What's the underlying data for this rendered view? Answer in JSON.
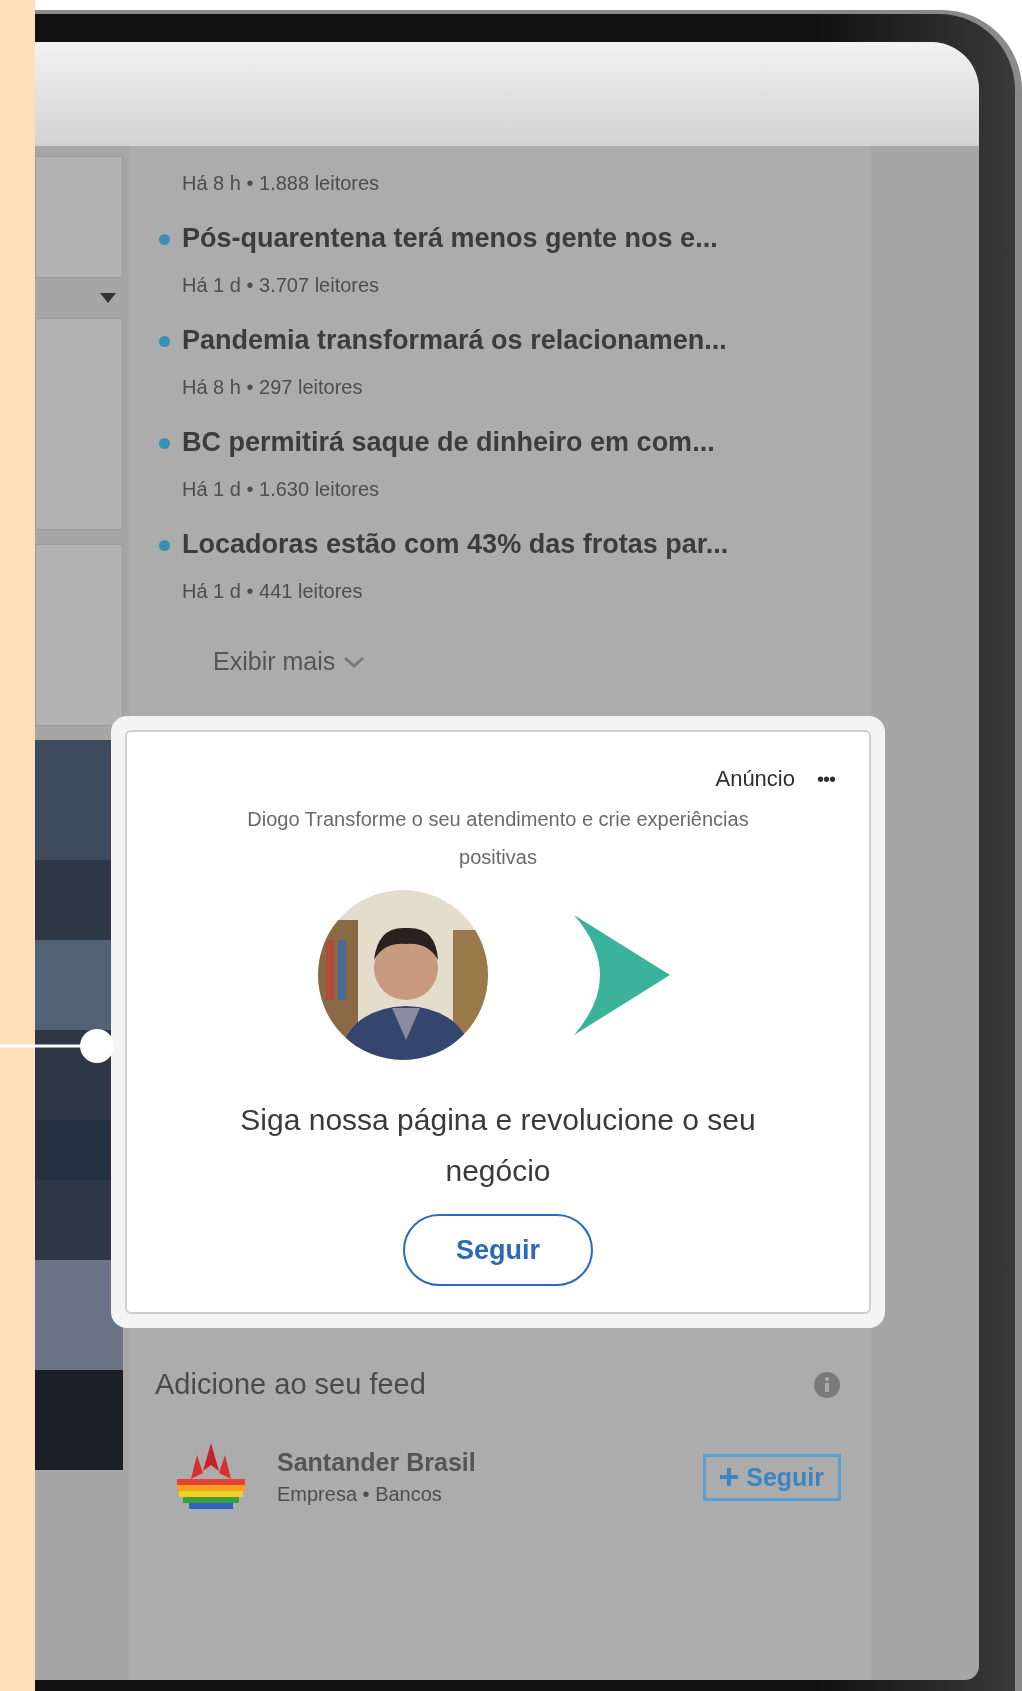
{
  "news": {
    "items": [
      {
        "meta": "Há 8 h • 1.888 leitores"
      },
      {
        "headline": "Pós-quarentena terá menos gente nos e...",
        "meta": "Há 1 d • 3.707 leitores"
      },
      {
        "headline": "Pandemia transformará os relacionamen...",
        "meta": "Há 8 h • 297 leitores"
      },
      {
        "headline": "BC permitirá saque de dinheiro em com...",
        "meta": "Há 1 d • 1.630 leitores"
      },
      {
        "headline": "Locadoras estão com 43% das frotas par...",
        "meta": "Há 1 d • 441 leitores"
      }
    ],
    "show_more": "Exibir mais"
  },
  "ad": {
    "label": "Anúncio",
    "menu": "•••",
    "description": "Diogo Transforme o seu atendimento e crie experiências positivas",
    "headline": "Siga nossa página e revolucione o seu negócio",
    "button": "Seguir"
  },
  "feed": {
    "title": "Adicione ao seu feed",
    "suggestions": [
      {
        "name": "Santander Brasil",
        "subtitle": "Empresa • Bancos",
        "button": "Seguir"
      }
    ]
  }
}
